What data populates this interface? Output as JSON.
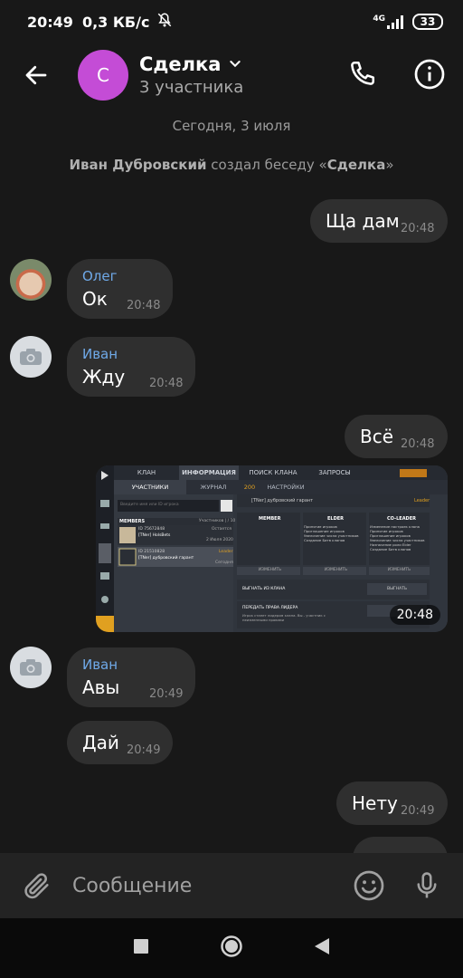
{
  "status_bar": {
    "time": "20:49",
    "speed": "0,3 КБ/с",
    "network": "4G",
    "battery": "33"
  },
  "header": {
    "avatar_letter": "С",
    "title": "Сделка",
    "subtitle": "3 участника"
  },
  "chat": {
    "date_separator": "Сегодня, 3 июля",
    "system_message": {
      "author": "Иван Дубровский",
      "text": "создал беседу «",
      "chat_name": "Сделка",
      "end": "»"
    },
    "messages": [
      {
        "sender": "",
        "text": "Ща дам",
        "time": "20:48",
        "outgoing": true
      },
      {
        "sender": "Олег",
        "text": "Ок",
        "time": "20:48",
        "outgoing": false
      },
      {
        "sender": "Иван",
        "text": "Жду",
        "time": "20:48",
        "outgoing": false
      },
      {
        "sender": "",
        "text": "Всё",
        "time": "20:48",
        "outgoing": true
      },
      {
        "sender": "",
        "text": "",
        "time": "20:48",
        "outgoing": true,
        "type": "image"
      },
      {
        "sender": "Иван",
        "text": "Авы",
        "time": "20:49",
        "outgoing": false
      },
      {
        "sender": "",
        "text": "Дай",
        "time": "20:49",
        "outgoing": false
      },
      {
        "sender": "",
        "text": "Нету",
        "time": "20:49",
        "outgoing": true
      }
    ],
    "screenshot_image": {
      "tabs": [
        "КЛАН",
        "ИНФОРМАЦИЯ",
        "ПОИСК КЛАНА",
        "ЗАПРОСЫ"
      ],
      "subtabs": [
        "УЧАСТНИКИ",
        "ЖУРНАЛ",
        "НАСТРОЙКИ"
      ],
      "search_placeholder": "Введите имя или ID игрока",
      "clan_tag_line": "[TNer] дубровский гарант",
      "leader_label": "Leader",
      "members_header": "MEMBERS",
      "members_count": "Участников | / 10",
      "member1_id": "ID 75672848",
      "member1_name": "[TNer] HolsBets",
      "member1_role": "Остается",
      "member1_date": "2 Июля 2020",
      "member2_id": "ID 21510828",
      "member2_name": "[TNer] дубровский гарант",
      "member2_role": "Leader",
      "member2_status": "Сегодня",
      "col_member": "MEMBER",
      "col_elder": "ELDER",
      "col_coleader": "CO-LEADER",
      "perm_member": [
        "Принятие игроков",
        "Приглашение игроков",
        "Увеличение числа участников",
        "Создание Битв кланов"
      ],
      "perm_elder": [
        "Принятие игроков",
        "Приглашение игроков",
        "Увеличение числа участников",
        "Создание Битв кланов"
      ],
      "perm_coleader": [
        "Изменение настроек клана",
        "Принятие игроков",
        "Приглашение игроков",
        "Увеличение числа участников",
        "Назначение роли Elder",
        "Создание Битв кланов"
      ],
      "change_label": "ИЗМЕНИТЬ",
      "kick_label": "ВЫГНАТЬ ИЗ КЛАНА",
      "kick_btn": "ВЫГНАТЬ",
      "transfer_label": "ПЕРЕДАТЬ ПРАВА ЛИДЕРА",
      "transfer_hint": "Игрок станет лидером клана. Вы - участник с неизменными правами",
      "counter": "200"
    }
  },
  "composer": {
    "placeholder": "Сообщение"
  },
  "colors": {
    "background": "#181818",
    "bubble": "#2f2f2f",
    "sender_name": "#6fa9e8",
    "avatar_group": "#c44cd6"
  }
}
